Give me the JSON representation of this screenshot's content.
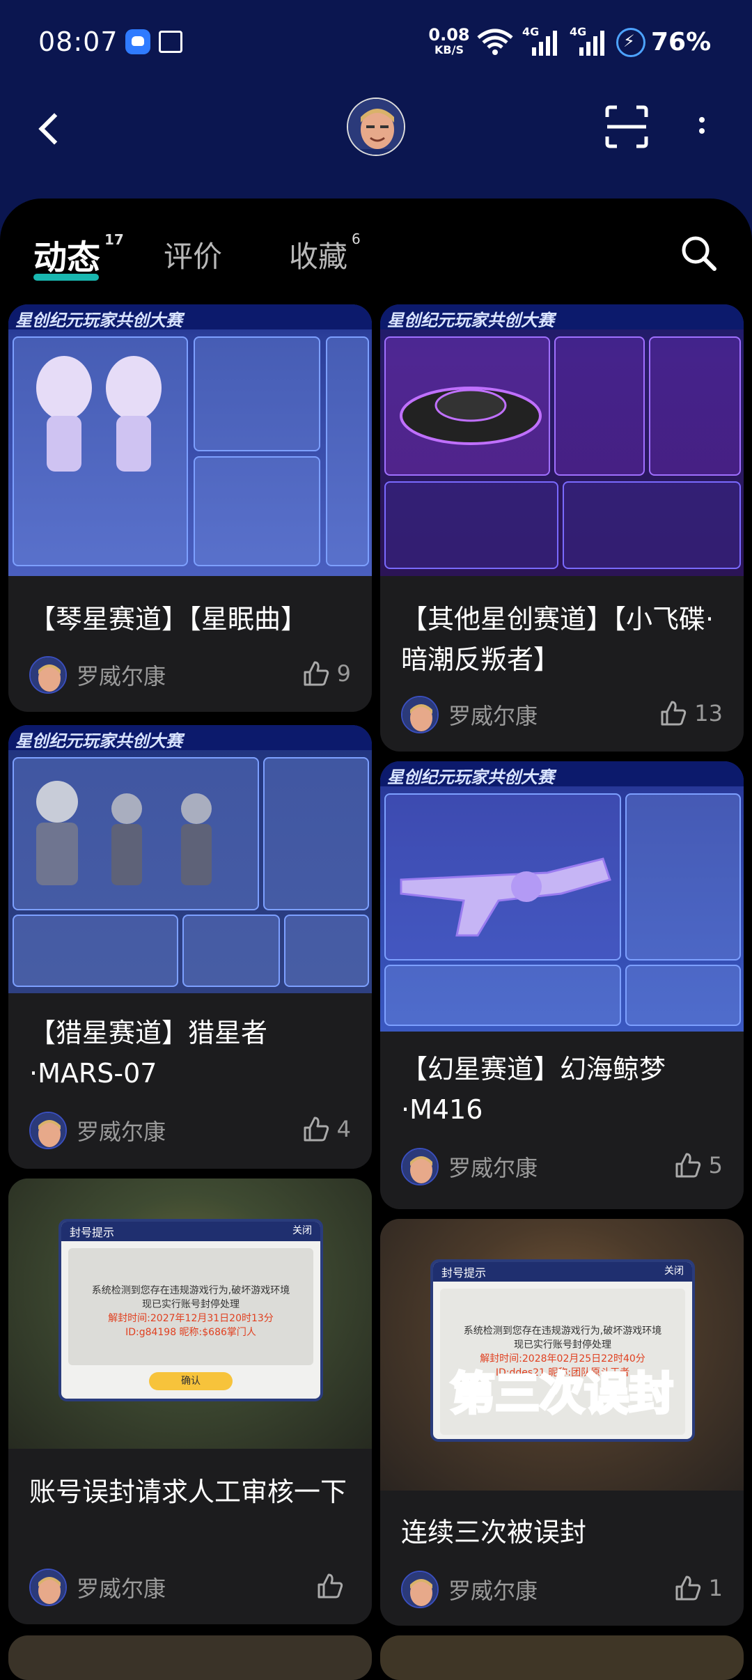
{
  "status_bar": {
    "time": "08:07",
    "net_speed_value": "0.08",
    "net_speed_unit": "KB/S",
    "signal_1": "4G",
    "signal_2": "4G",
    "battery": "76%"
  },
  "tabs": [
    {
      "label": "动态",
      "count": "17"
    },
    {
      "label": "评价",
      "count": ""
    },
    {
      "label": "收藏",
      "count": "6"
    }
  ],
  "author": "罗威尔康",
  "cards": [
    {
      "title": "【琴星赛道】【星眠曲】",
      "likes": "9",
      "banner": "星创纪元玩家共创大赛"
    },
    {
      "title": "【其他星创赛道】【小飞碟·暗潮反叛者】",
      "likes": "13",
      "banner": "星创纪元玩家共创大赛"
    },
    {
      "title": "【猎星赛道】猎星者·MARS-07",
      "likes": "4",
      "banner": "星创纪元玩家共创大赛"
    },
    {
      "title": "【幻星赛道】幻海鲸梦·M416",
      "likes": "5",
      "banner": "星创纪元玩家共创大赛"
    },
    {
      "title": "账号误封请求人工审核一下",
      "likes": "",
      "banner": ""
    },
    {
      "title": "连续三次被误封",
      "likes": "1",
      "banner": ""
    }
  ],
  "dialog_1": {
    "title": "封号提示",
    "close": "关闭",
    "line1": "系统检测到您存在违规游戏行为,破坏游戏环境",
    "line2": "现已实行账号封停处理",
    "line3": "解封时间:2027年12月31日20时13分",
    "line4": "ID:g84198 昵称:$686掌门人",
    "confirm": "确认"
  },
  "dialog_2": {
    "title": "封号提示",
    "close": "关闭",
    "line1": "系统检测到您存在违规游戏行为,破坏游戏环境",
    "line2": "现已实行账号封停处理",
    "line3": "解封时间:2028年02月25日22时40分",
    "line4": "ID:ddes21 昵称:团队原斗王者",
    "overlay": "第三次误封"
  },
  "colors": {
    "header_bg": "#0b1650",
    "tab_accent": "#19b7b0",
    "card_bg": "#1c1c1e"
  }
}
